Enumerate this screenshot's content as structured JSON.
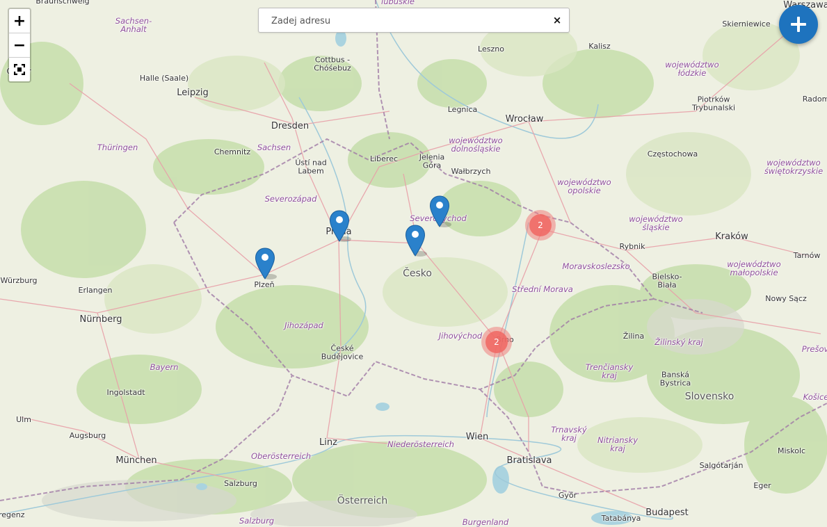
{
  "search": {
    "placeholder": "Zadej adresu",
    "value": "",
    "clear_label": "×"
  },
  "zoom": {
    "in_label": "+",
    "out_label": "−"
  },
  "fab": {
    "icon": "plus-icon"
  },
  "colors": {
    "accent": "#1e73be",
    "marker": "#2a81cb",
    "cluster": "#f0665f"
  },
  "markers": [
    {
      "name": "marker-plzen"
    },
    {
      "name": "marker-praha"
    },
    {
      "name": "marker-cesko"
    },
    {
      "name": "marker-severovychod"
    }
  ],
  "clusters": [
    {
      "count": "2"
    },
    {
      "count": "2"
    }
  ],
  "labels": [
    {
      "text": "Braunschweig",
      "cls": "small"
    },
    {
      "text": "Sachsen-\nAnhalt",
      "cls": "region"
    },
    {
      "text": "lubuskie",
      "cls": "region"
    },
    {
      "text": "Warszawa",
      "cls": "city"
    },
    {
      "text": "Skierniewice",
      "cls": "small"
    },
    {
      "text": "Kalisz",
      "cls": "small"
    },
    {
      "text": "Leszno",
      "cls": "small"
    },
    {
      "text": "Cottbus -\nChóśebuz",
      "cls": "small"
    },
    {
      "text": "Halle (Saale)",
      "cls": "small"
    },
    {
      "text": "Leipzig",
      "cls": "city"
    },
    {
      "text": "Goslar",
      "cls": "small"
    },
    {
      "text": "województwo\nłódzkie",
      "cls": "region"
    },
    {
      "text": "Piotrków\nTrybunalski",
      "cls": "small"
    },
    {
      "text": "Radom",
      "cls": "small"
    },
    {
      "text": "Legnica",
      "cls": "small"
    },
    {
      "text": "Wrocław",
      "cls": "city"
    },
    {
      "text": "Dresden",
      "cls": "city"
    },
    {
      "text": "województwo\ndolnośląskie",
      "cls": "region"
    },
    {
      "text": "Thüringen",
      "cls": "region"
    },
    {
      "text": "Chemnitz",
      "cls": "small"
    },
    {
      "text": "Sachsen",
      "cls": "region"
    },
    {
      "text": "Częstochowa",
      "cls": "small"
    },
    {
      "text": "Ústí nad\nLabem",
      "cls": "small"
    },
    {
      "text": "Liberec",
      "cls": "small"
    },
    {
      "text": "Jelenia\nGóra",
      "cls": "small"
    },
    {
      "text": "Wałbrzych",
      "cls": "small"
    },
    {
      "text": "województwo\nświętokrzyskie",
      "cls": "region"
    },
    {
      "text": "województwo\nopolskie",
      "cls": "region"
    },
    {
      "text": "Severozápad",
      "cls": "region"
    },
    {
      "text": "Severovýchod",
      "cls": "region"
    },
    {
      "text": "Praha",
      "cls": "city"
    },
    {
      "text": "województwo\nśląskie",
      "cls": "region"
    },
    {
      "text": "Rybnik",
      "cls": "small"
    },
    {
      "text": "Kraków",
      "cls": "city"
    },
    {
      "text": "Tarnów",
      "cls": "small"
    },
    {
      "text": "Moravskoslezsko",
      "cls": "region"
    },
    {
      "text": "Plzeň",
      "cls": "small"
    },
    {
      "text": "Česko",
      "cls": "country"
    },
    {
      "text": "Bielsko-\nBiała",
      "cls": "small"
    },
    {
      "text": "województwo\nmałopolskie",
      "cls": "region"
    },
    {
      "text": "Würzburg",
      "cls": "small"
    },
    {
      "text": "Erlangen",
      "cls": "small"
    },
    {
      "text": "Střední Morava",
      "cls": "region"
    },
    {
      "text": "Nowy Sącz",
      "cls": "small"
    },
    {
      "text": "Nürnberg",
      "cls": "city"
    },
    {
      "text": "Jihozápad",
      "cls": "region"
    },
    {
      "text": "Jihovýchod",
      "cls": "region"
    },
    {
      "text": "Brno",
      "cls": "small"
    },
    {
      "text": "Žilina",
      "cls": "small"
    },
    {
      "text": "Žilinský kraj",
      "cls": "region"
    },
    {
      "text": "Prešov",
      "cls": "region"
    },
    {
      "text": "České\nBudějovice",
      "cls": "small"
    },
    {
      "text": "Bayern",
      "cls": "region"
    },
    {
      "text": "Trenčiansky\nkraj",
      "cls": "region"
    },
    {
      "text": "Banská\nBystrica",
      "cls": "small"
    },
    {
      "text": "Ingolstadt",
      "cls": "small"
    },
    {
      "text": "Slovensko",
      "cls": "country"
    },
    {
      "text": "Košice",
      "cls": "region"
    },
    {
      "text": "Ulm",
      "cls": "small"
    },
    {
      "text": "Augsburg",
      "cls": "small"
    },
    {
      "text": "Trnavský\nkraj",
      "cls": "region"
    },
    {
      "text": "Nitriansky\nkraj",
      "cls": "region"
    },
    {
      "text": "Linz",
      "cls": "city"
    },
    {
      "text": "Niederösterreich",
      "cls": "region"
    },
    {
      "text": "Wien",
      "cls": "city"
    },
    {
      "text": "Miskolc",
      "cls": "small"
    },
    {
      "text": "München",
      "cls": "city"
    },
    {
      "text": "Oberösterreich",
      "cls": "region"
    },
    {
      "text": "Bratislava",
      "cls": "city"
    },
    {
      "text": "Salgótarján",
      "cls": "small"
    },
    {
      "text": "Salzburg",
      "cls": "small"
    },
    {
      "text": "Eger",
      "cls": "small"
    },
    {
      "text": "Österreich",
      "cls": "country"
    },
    {
      "text": "Győr",
      "cls": "small"
    },
    {
      "text": "Budapest",
      "cls": "city"
    },
    {
      "text": "Bregenz",
      "cls": "small"
    },
    {
      "text": "Salzburg",
      "cls": "region"
    },
    {
      "text": "Burgenland",
      "cls": "region"
    },
    {
      "text": "Tatabánya",
      "cls": "small"
    }
  ]
}
